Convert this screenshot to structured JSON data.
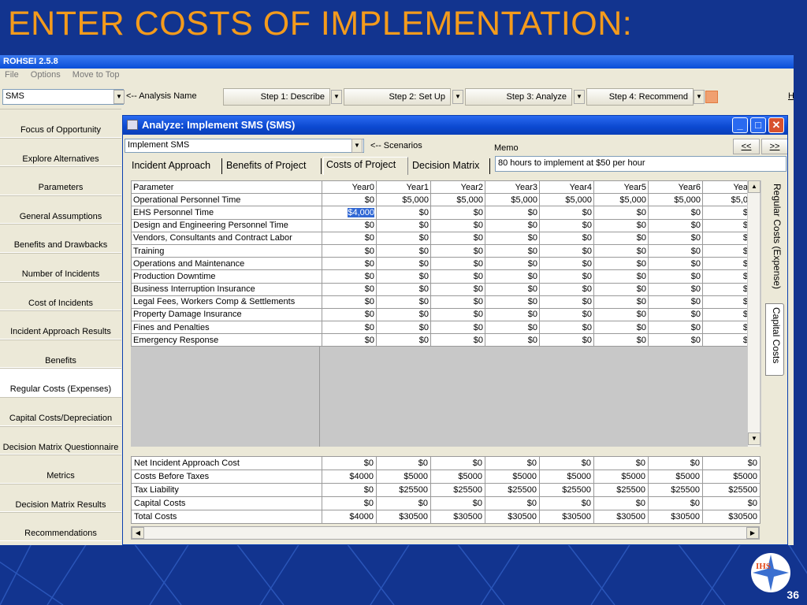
{
  "slide": {
    "title": "ENTER COSTS OF IMPLEMENTATION:",
    "number": "36",
    "logo_text": "IHS"
  },
  "app": {
    "title": "ROHSEI 2.5.8",
    "menu": [
      "File",
      "Options",
      "Move to Top"
    ],
    "analysis_value": "SMS",
    "analysis_label": "<-- Analysis Name",
    "steps": [
      "Step 1: Describe",
      "Step 2: Set Up",
      "Step 3: Analyze",
      "Step 4: Recommend"
    ],
    "toolbar_extra": "H"
  },
  "leftnav": {
    "items": [
      "Focus of Opportunity",
      "Explore Alternatives",
      "Parameters",
      "General Assumptions",
      "Benefits and Drawbacks",
      "Number of Incidents",
      "Cost of Incidents",
      "Incident Approach Results",
      "Benefits",
      "Regular Costs (Expenses)",
      "Capital Costs/Depreciation",
      "Decision Matrix Questionnaire",
      "Metrics",
      "Decision Matrix Results",
      "Recommendations"
    ],
    "active_index": 9
  },
  "dialog": {
    "title": "Analyze: Implement SMS (SMS)",
    "scenario_value": "Implement SMS",
    "scenario_label": "<-- Scenarios",
    "memo_label": "Memo",
    "prev_label": "<<",
    "next_label": ">>",
    "memo_value": "80 hours to implement at $50 per hour",
    "tabs": [
      "Incident Approach",
      "Benefits of Project",
      "Costs of Project",
      "Decision Matrix"
    ],
    "active_tab": 2,
    "side_tabs": [
      "Regular Costs (Expense)",
      "Capital Costs"
    ],
    "active_side_tab": 0,
    "grid": {
      "columns": [
        "Parameter",
        "Year0",
        "Year1",
        "Year2",
        "Year3",
        "Year4",
        "Year5",
        "Year6",
        "Yea"
      ],
      "rows": [
        [
          "Operational Personnel Time",
          "$0",
          "$5,000",
          "$5,000",
          "$5,000",
          "$5,000",
          "$5,000",
          "$5,000",
          "$5,0"
        ],
        [
          "EHS Personnel Time",
          "$4,000",
          "$0",
          "$0",
          "$0",
          "$0",
          "$0",
          "$0",
          "$"
        ],
        [
          "Design and Engineering Personnel Time",
          "$0",
          "$0",
          "$0",
          "$0",
          "$0",
          "$0",
          "$0",
          "$"
        ],
        [
          "Vendors, Consultants and Contract Labor",
          "$0",
          "$0",
          "$0",
          "$0",
          "$0",
          "$0",
          "$0",
          "$"
        ],
        [
          "Training",
          "$0",
          "$0",
          "$0",
          "$0",
          "$0",
          "$0",
          "$0",
          "$"
        ],
        [
          "Operations and Maintenance",
          "$0",
          "$0",
          "$0",
          "$0",
          "$0",
          "$0",
          "$0",
          "$"
        ],
        [
          "Production Downtime",
          "$0",
          "$0",
          "$0",
          "$0",
          "$0",
          "$0",
          "$0",
          "$"
        ],
        [
          "Business Interruption Insurance",
          "$0",
          "$0",
          "$0",
          "$0",
          "$0",
          "$0",
          "$0",
          "$"
        ],
        [
          "Legal Fees, Workers Comp & Settlements",
          "$0",
          "$0",
          "$0",
          "$0",
          "$0",
          "$0",
          "$0",
          "$"
        ],
        [
          "Property Damage Insurance",
          "$0",
          "$0",
          "$0",
          "$0",
          "$0",
          "$0",
          "$0",
          "$"
        ],
        [
          "Fines and Penalties",
          "$0",
          "$0",
          "$0",
          "$0",
          "$0",
          "$0",
          "$0",
          "$"
        ],
        [
          "Emergency Response",
          "$0",
          "$0",
          "$0",
          "$0",
          "$0",
          "$0",
          "$0",
          "$"
        ]
      ]
    },
    "totals": [
      [
        "Net Incident Approach Cost",
        "$0",
        "$0",
        "$0",
        "$0",
        "$0",
        "$0",
        "$0",
        "$0"
      ],
      [
        "Costs Before Taxes",
        "$4000",
        "$5000",
        "$5000",
        "$5000",
        "$5000",
        "$5000",
        "$5000",
        "$5000"
      ],
      [
        "Tax Liability",
        "$0",
        "$25500",
        "$25500",
        "$25500",
        "$25500",
        "$25500",
        "$25500",
        "$25500"
      ],
      [
        "Capital Costs",
        "$0",
        "$0",
        "$0",
        "$0",
        "$0",
        "$0",
        "$0",
        "$0"
      ],
      [
        "Total Costs",
        "$4000",
        "$30500",
        "$30500",
        "$30500",
        "$30500",
        "$30500",
        "$30500",
        "$30500"
      ]
    ]
  }
}
